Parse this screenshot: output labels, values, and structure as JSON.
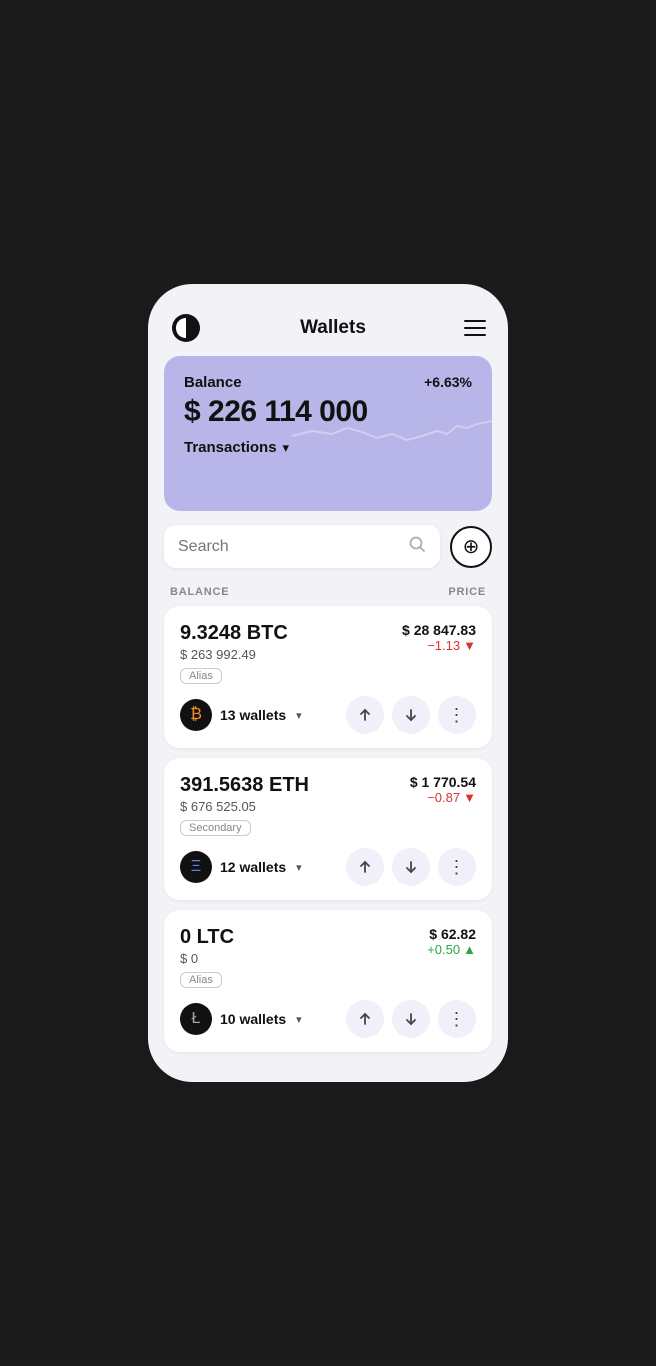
{
  "header": {
    "title": "Wallets",
    "menu_label": "menu"
  },
  "balance_card": {
    "label": "Balance",
    "change": "+6.63%",
    "amount": "$ 226 114 000",
    "transactions_label": "Transactions"
  },
  "search": {
    "placeholder": "Search"
  },
  "add_button_label": "+",
  "col_headers": {
    "left": "BALANCE",
    "right": "PRICE"
  },
  "assets": [
    {
      "id": "btc",
      "amount": "9.3248 BTC",
      "usd_value": "$ 263 992.49",
      "tag": "Alias",
      "price": "$ 28 847.83",
      "change": "−1.13",
      "change_direction": "negative",
      "wallet_count": "13 wallets",
      "coin_symbol": "₿",
      "coin_class": "coin-btc"
    },
    {
      "id": "eth",
      "amount": "391.5638 ETH",
      "usd_value": "$ 676 525.05",
      "tag": "Secondary",
      "price": "$ 1 770.54",
      "change": "−0.87",
      "change_direction": "negative",
      "wallet_count": "12 wallets",
      "coin_symbol": "Ξ",
      "coin_class": "coin-eth"
    },
    {
      "id": "ltc",
      "amount": "0 LTC",
      "usd_value": "$ 0",
      "tag": "Alias",
      "price": "$ 62.82",
      "change": "+0.50",
      "change_direction": "positive",
      "wallet_count": "10 wallets",
      "coin_symbol": "Ł",
      "coin_class": "coin-ltc"
    }
  ],
  "icons": {
    "up_arrow": "↑",
    "down_arrow": "↓",
    "more": "⋮",
    "search": "⌕",
    "chevron_down": "▾",
    "triangle_down": "▼",
    "triangle_up": "▲"
  },
  "colors": {
    "accent": "#b8b5e8",
    "negative": "#e03030",
    "positive": "#27a844",
    "bg": "#f2f2f7"
  }
}
